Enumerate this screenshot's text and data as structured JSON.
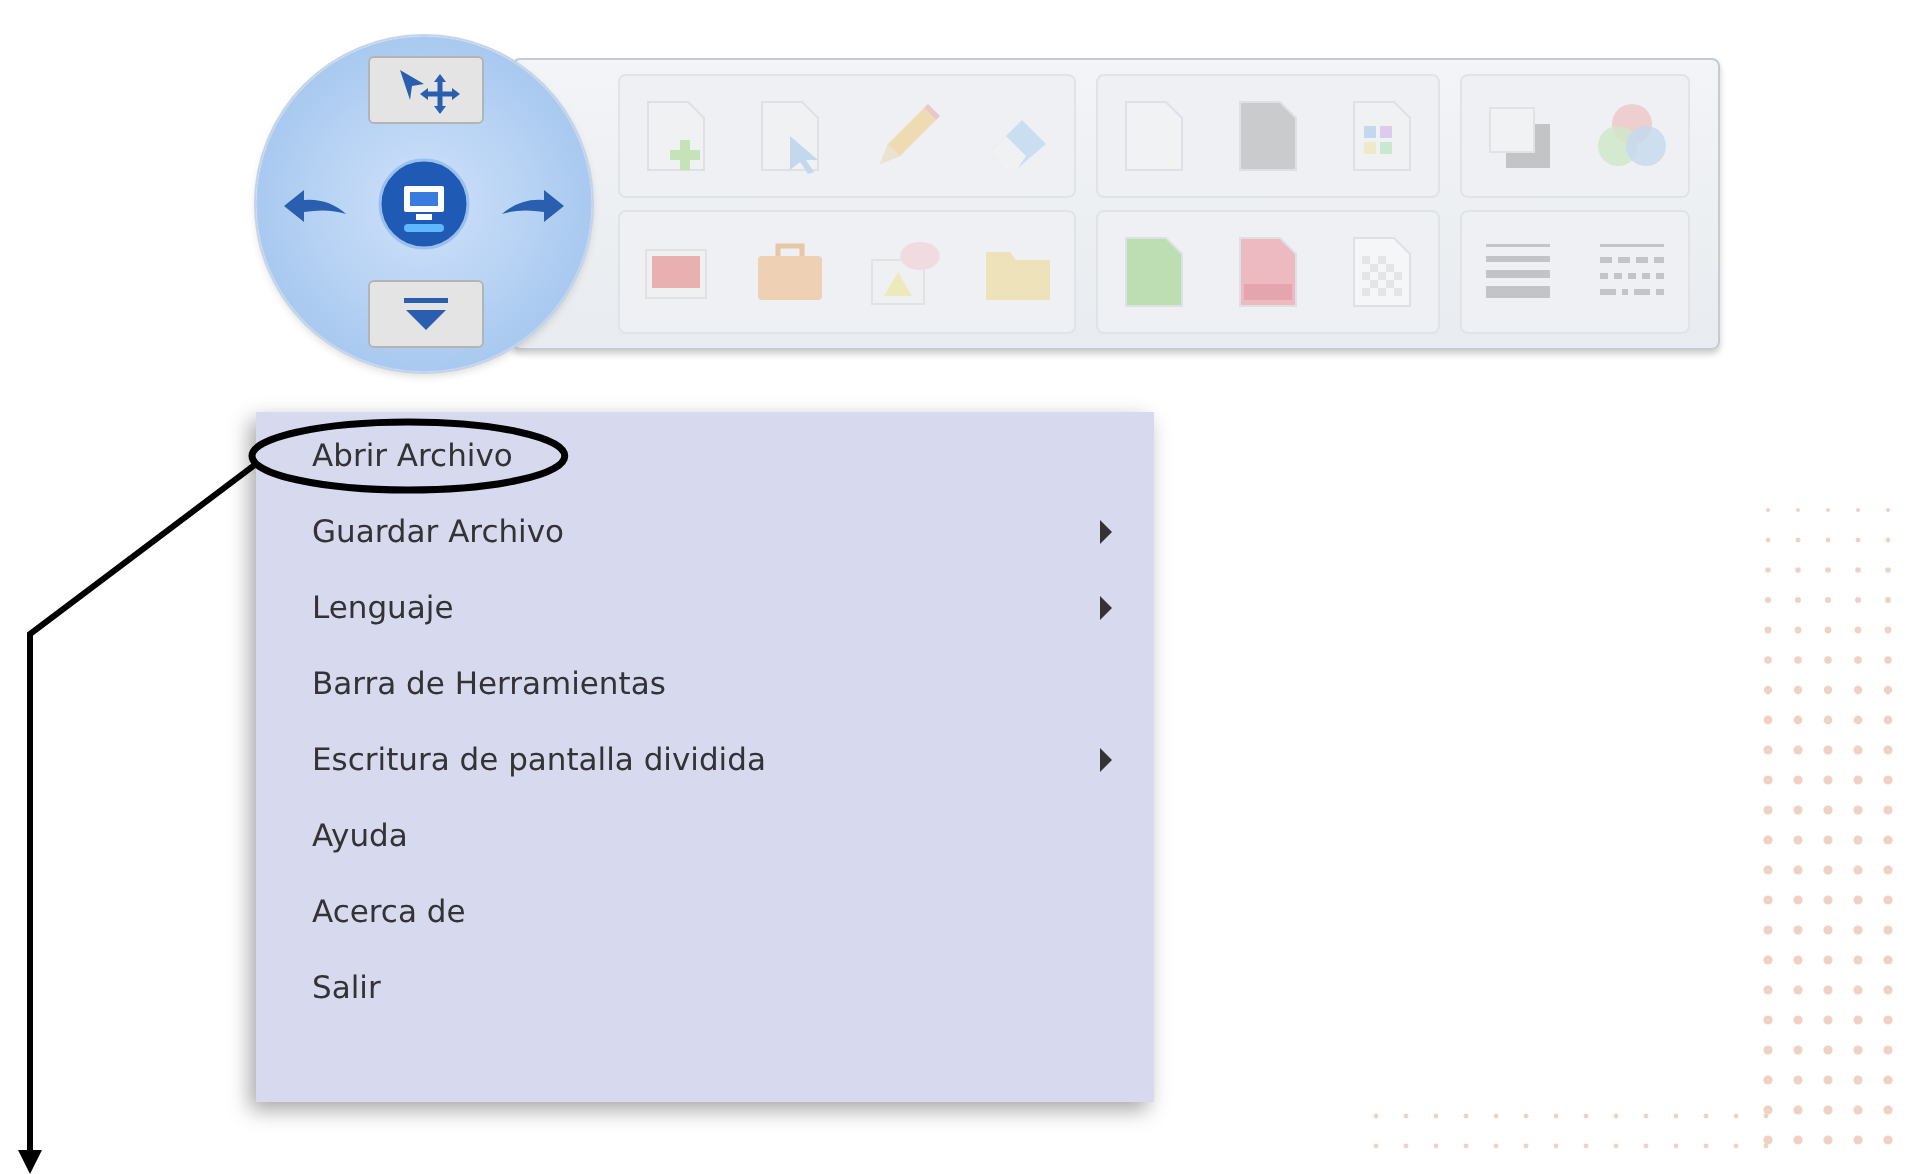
{
  "menu": {
    "items": [
      {
        "label": "Abrir Archivo",
        "submenu": false,
        "circled": true
      },
      {
        "label": "Guardar Archivo",
        "submenu": true,
        "circled": false
      },
      {
        "label": "Lenguaje",
        "submenu": true,
        "circled": false
      },
      {
        "label": "Barra de Herramientas",
        "submenu": false,
        "circled": false
      },
      {
        "label": "Escritura de pantalla dividida",
        "submenu": true,
        "circled": false
      },
      {
        "label": "Ayuda",
        "submenu": false,
        "circled": false
      },
      {
        "label": "Acerca de",
        "submenu": false,
        "circled": false
      },
      {
        "label": "Salir",
        "submenu": false,
        "circled": false
      }
    ]
  }
}
